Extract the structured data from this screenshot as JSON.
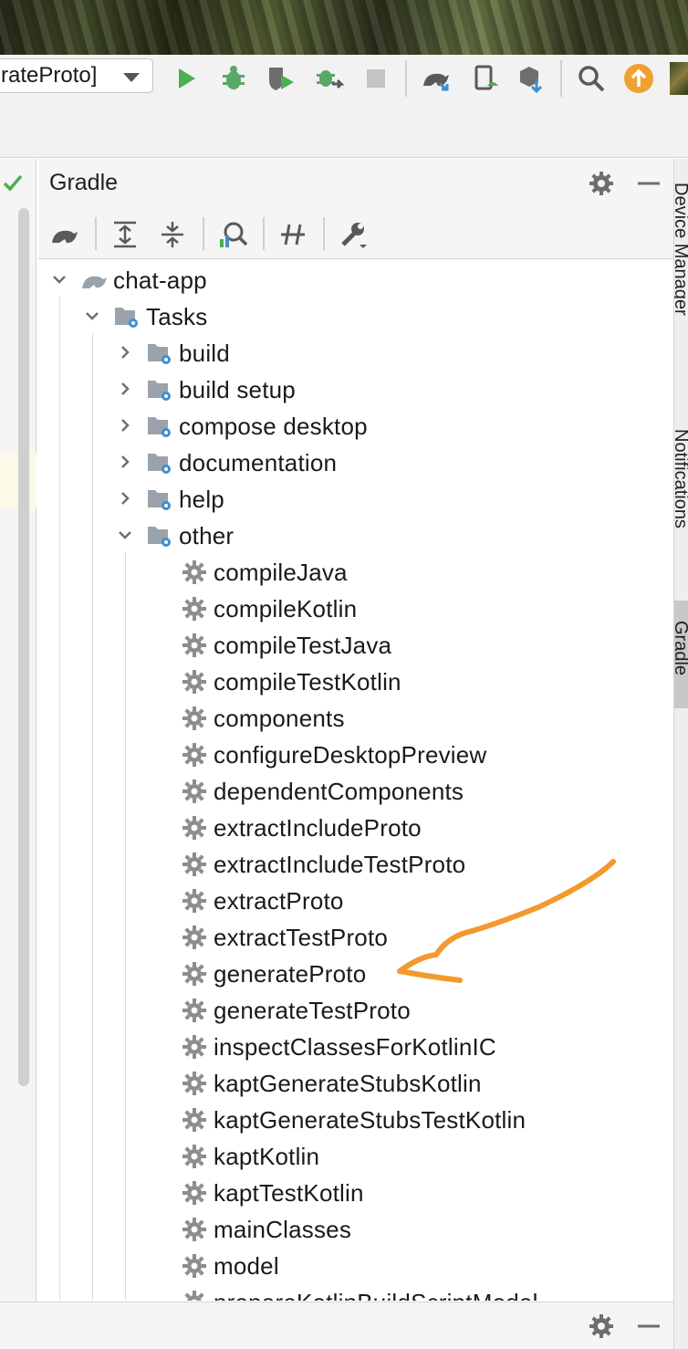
{
  "toolbar": {
    "run_config": "rateProto]",
    "icons": [
      "play-icon",
      "debug-bug-icon",
      "run-coverage-icon",
      "profiler-icon",
      "stop-icon",
      "gradle-sync-icon",
      "device-icon",
      "sdk-manager-icon",
      "search-icon",
      "update-icon",
      "avatar"
    ]
  },
  "gradle_panel": {
    "title": "Gradle",
    "tree": {
      "root": "chat-app",
      "tasks": "Tasks",
      "groups": [
        "build",
        "build setup",
        "compose desktop",
        "documentation",
        "help"
      ],
      "expanded_group": "other",
      "other_tasks": [
        "compileJava",
        "compileKotlin",
        "compileTestJava",
        "compileTestKotlin",
        "components",
        "configureDesktopPreview",
        "dependentComponents",
        "extractIncludeProto",
        "extractIncludeTestProto",
        "extractProto",
        "extractTestProto",
        "generateProto",
        "generateTestProto",
        "inspectClassesForKotlinIC",
        "kaptGenerateStubsKotlin",
        "kaptGenerateStubsTestKotlin",
        "kaptKotlin",
        "kaptTestKotlin",
        "mainClasses",
        "model",
        "prepareKotlinBuildScriptModel"
      ]
    }
  },
  "right_tabs": [
    "Device Manager",
    "Notifications",
    "Gradle"
  ],
  "colors": {
    "accent_orange": "#f29a2e",
    "run_green": "#4caf50",
    "folder_gray": "#9aa3ab",
    "gear_gray": "#8c8c8c"
  }
}
